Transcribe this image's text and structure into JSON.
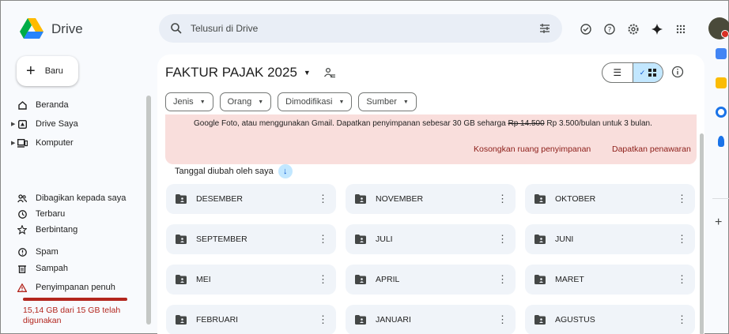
{
  "app": {
    "name": "Drive"
  },
  "search": {
    "placeholder": "Telusuri di Drive"
  },
  "colors": {
    "accent": "#0b57d0",
    "selected": "#c2e7ff",
    "banner": "#f9dedc",
    "warning": "#b3261e"
  },
  "sidebar": {
    "new_label": "Baru",
    "items": [
      {
        "label": "Beranda",
        "icon": "home-icon"
      },
      {
        "label": "Drive Saya",
        "icon": "drive-icon"
      },
      {
        "label": "Komputer",
        "icon": "computer-icon"
      },
      {
        "label": "Dibagikan kepada saya",
        "icon": "shared-icon"
      },
      {
        "label": "Terbaru",
        "icon": "clock-icon"
      },
      {
        "label": "Berbintang",
        "icon": "star-icon"
      },
      {
        "label": "Spam",
        "icon": "spam-icon"
      },
      {
        "label": "Sampah",
        "icon": "trash-icon"
      },
      {
        "label": "Penyimpanan penuh",
        "icon": "warning-icon"
      }
    ],
    "storage_text": "15,14 GB dari 15 GB telah digunakan",
    "storage_fraction": 1.0
  },
  "main": {
    "title": "FAKTUR PAJAK 2025",
    "filters": [
      "Jenis",
      "Orang",
      "Dimodifikasi",
      "Sumber"
    ],
    "banner": {
      "message_pre": "Google Foto, atau menggunakan Gmail. Dapatkan penyimpanan sebesar 30 GB seharga ",
      "old_price": "Rp 14.500",
      "message_post": " Rp 3.500/bulan untuk 3 bulan.",
      "action_clear": "Kosongkan ruang penyimpanan",
      "action_offer": "Dapatkan penawaran"
    },
    "sort_label": "Tanggal diubah oleh saya",
    "folders": [
      "DESEMBER",
      "NOVEMBER",
      "OKTOBER",
      "SEPTEMBER",
      "JULI",
      "JUNI",
      "MEI",
      "APRIL",
      "MARET",
      "FEBRUARI",
      "JANUARI",
      "AGUSTUS"
    ]
  }
}
